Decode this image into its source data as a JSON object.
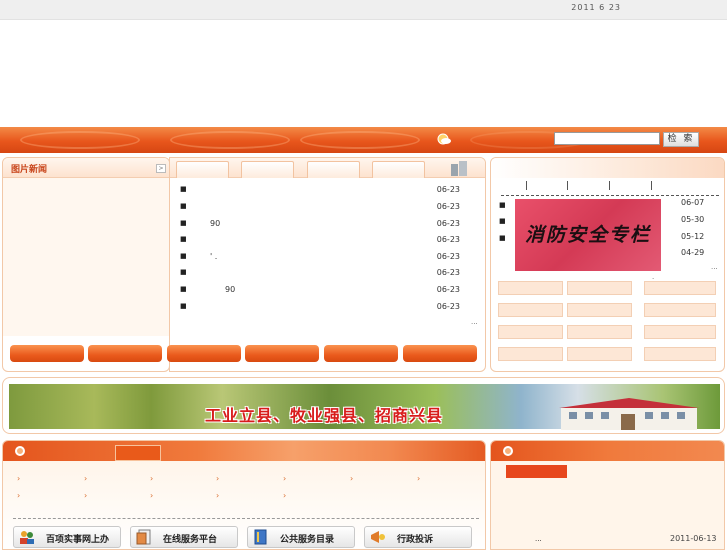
{
  "header": {
    "date": "2011 6 23"
  },
  "search": {
    "placeholder": "",
    "button_label": "检 索"
  },
  "photo_news": {
    "title": "图片新闻",
    "more_symbol": ">"
  },
  "news": {
    "items": [
      {
        "text": "",
        "date": "06-23"
      },
      {
        "text": "",
        "date": "06-23"
      },
      {
        "text": "90",
        "date": "06-23"
      },
      {
        "text": "",
        "date": "06-23"
      },
      {
        "text": "' .",
        "date": "06-23"
      },
      {
        "text": "",
        "date": "06-23"
      },
      {
        "text": "90",
        "date": "06-23"
      },
      {
        "text": "",
        "date": "06-23"
      }
    ],
    "more": "...",
    "bullet": "■"
  },
  "right": {
    "banner_text": "消防安全专栏",
    "dates": [
      "06-07",
      "05-30",
      "05-12",
      "04-29"
    ],
    "bullet": "■",
    "more": "...",
    "dot": "·"
  },
  "banner": {
    "slogan": "工业立县、牧业强县、招商兴县"
  },
  "services": {
    "chevron": "›",
    "buttons": [
      {
        "label": "百项实事网上办",
        "icon": "people-icon"
      },
      {
        "label": "在线服务平台",
        "icon": "document-icon"
      },
      {
        "label": "公共服务目录",
        "icon": "book-icon"
      },
      {
        "label": "行政投诉",
        "icon": "megaphone-icon"
      }
    ]
  },
  "notice": {
    "bullet": "■",
    "dots": "...",
    "date": "2011-06-13"
  },
  "colors": {
    "accent": "#e8561c",
    "banner_red": "#d43a55",
    "slogan_red": "#d81b1b"
  }
}
